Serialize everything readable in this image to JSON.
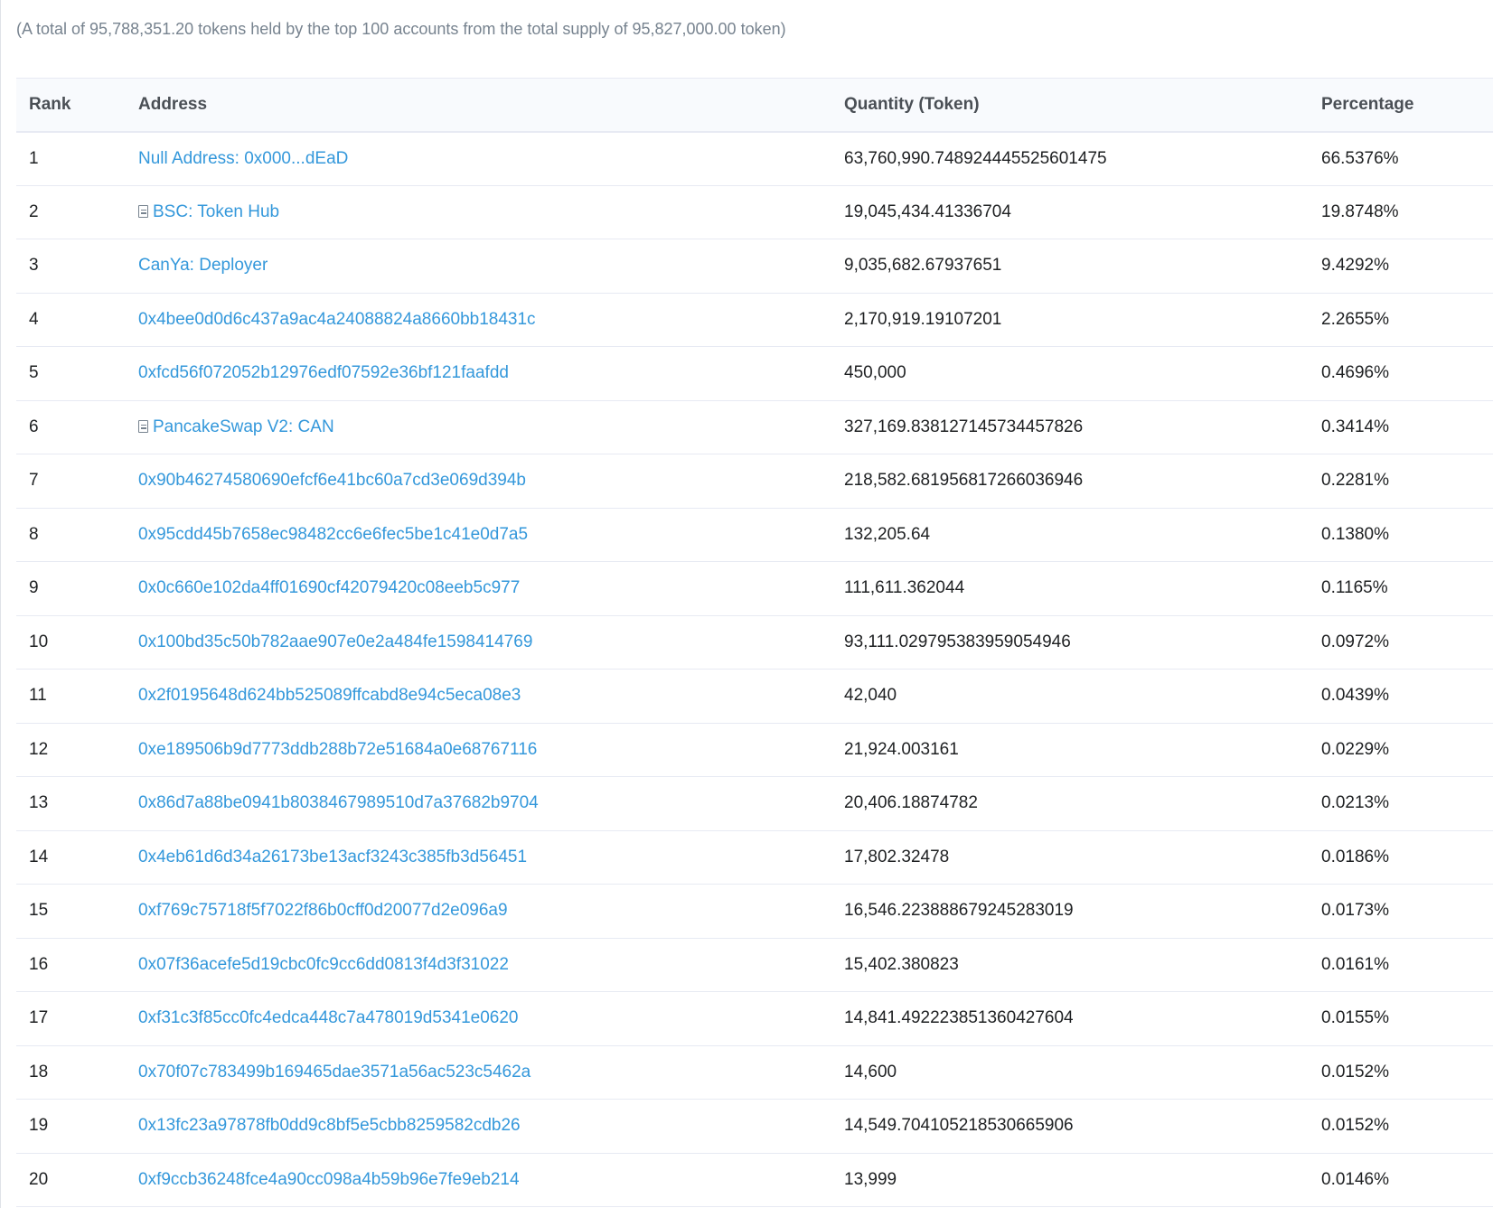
{
  "summary": "(A total of 95,788,351.20 tokens held by the top 100 accounts from the total supply of 95,827,000.00 token)",
  "table": {
    "headers": {
      "rank": "Rank",
      "address": "Address",
      "quantity": "Quantity (Token)",
      "percentage": "Percentage"
    },
    "rows": [
      {
        "rank": "1",
        "address": "Null Address: 0x000...dEaD",
        "contract": false,
        "quantity": "63,760,990.748924445525601475",
        "percentage": "66.5376%"
      },
      {
        "rank": "2",
        "address": "BSC: Token Hub",
        "contract": true,
        "quantity": "19,045,434.41336704",
        "percentage": "19.8748%"
      },
      {
        "rank": "3",
        "address": "CanYa: Deployer",
        "contract": false,
        "quantity": "9,035,682.67937651",
        "percentage": "9.4292%"
      },
      {
        "rank": "4",
        "address": "0x4bee0d0d6c437a9ac4a24088824a8660bb18431c",
        "contract": false,
        "quantity": "2,170,919.19107201",
        "percentage": "2.2655%"
      },
      {
        "rank": "5",
        "address": "0xfcd56f072052b12976edf07592e36bf121faafdd",
        "contract": false,
        "quantity": "450,000",
        "percentage": "0.4696%"
      },
      {
        "rank": "6",
        "address": "PancakeSwap V2: CAN",
        "contract": true,
        "quantity": "327,169.838127145734457826",
        "percentage": "0.3414%"
      },
      {
        "rank": "7",
        "address": "0x90b46274580690efcf6e41bc60a7cd3e069d394b",
        "contract": false,
        "quantity": "218,582.681956817266036946",
        "percentage": "0.2281%"
      },
      {
        "rank": "8",
        "address": "0x95cdd45b7658ec98482cc6e6fec5be1c41e0d7a5",
        "contract": false,
        "quantity": "132,205.64",
        "percentage": "0.1380%"
      },
      {
        "rank": "9",
        "address": "0x0c660e102da4ff01690cf42079420c08eeb5c977",
        "contract": false,
        "quantity": "111,611.362044",
        "percentage": "0.1165%"
      },
      {
        "rank": "10",
        "address": "0x100bd35c50b782aae907e0e2a484fe1598414769",
        "contract": false,
        "quantity": "93,111.029795383959054946",
        "percentage": "0.0972%"
      },
      {
        "rank": "11",
        "address": "0x2f0195648d624bb525089ffcabd8e94c5eca08e3",
        "contract": false,
        "quantity": "42,040",
        "percentage": "0.0439%"
      },
      {
        "rank": "12",
        "address": "0xe189506b9d7773ddb288b72e51684a0e68767116",
        "contract": false,
        "quantity": "21,924.003161",
        "percentage": "0.0229%"
      },
      {
        "rank": "13",
        "address": "0x86d7a88be0941b8038467989510d7a37682b9704",
        "contract": false,
        "quantity": "20,406.18874782",
        "percentage": "0.0213%"
      },
      {
        "rank": "14",
        "address": "0x4eb61d6d34a26173be13acf3243c385fb3d56451",
        "contract": false,
        "quantity": "17,802.32478",
        "percentage": "0.0186%"
      },
      {
        "rank": "15",
        "address": "0xf769c75718f5f7022f86b0cff0d20077d2e096a9",
        "contract": false,
        "quantity": "16,546.223888679245283019",
        "percentage": "0.0173%"
      },
      {
        "rank": "16",
        "address": "0x07f36acefe5d19cbc0fc9cc6dd0813f4d3f31022",
        "contract": false,
        "quantity": "15,402.380823",
        "percentage": "0.0161%"
      },
      {
        "rank": "17",
        "address": "0xf31c3f85cc0fc4edca448c7a478019d5341e0620",
        "contract": false,
        "quantity": "14,841.492223851360427604",
        "percentage": "0.0155%"
      },
      {
        "rank": "18",
        "address": "0x70f07c783499b169465dae3571a56ac523c5462a",
        "contract": false,
        "quantity": "14,600",
        "percentage": "0.0152%"
      },
      {
        "rank": "19",
        "address": "0x13fc23a97878fb0dd9c8bf5e5cbb8259582cdb26",
        "contract": false,
        "quantity": "14,549.704105218530665906",
        "percentage": "0.0152%"
      },
      {
        "rank": "20",
        "address": "0xf9ccb36248fce4a90cc098a4b59b96e7fe9eb214",
        "contract": false,
        "quantity": "13,999",
        "percentage": "0.0146%"
      }
    ]
  }
}
